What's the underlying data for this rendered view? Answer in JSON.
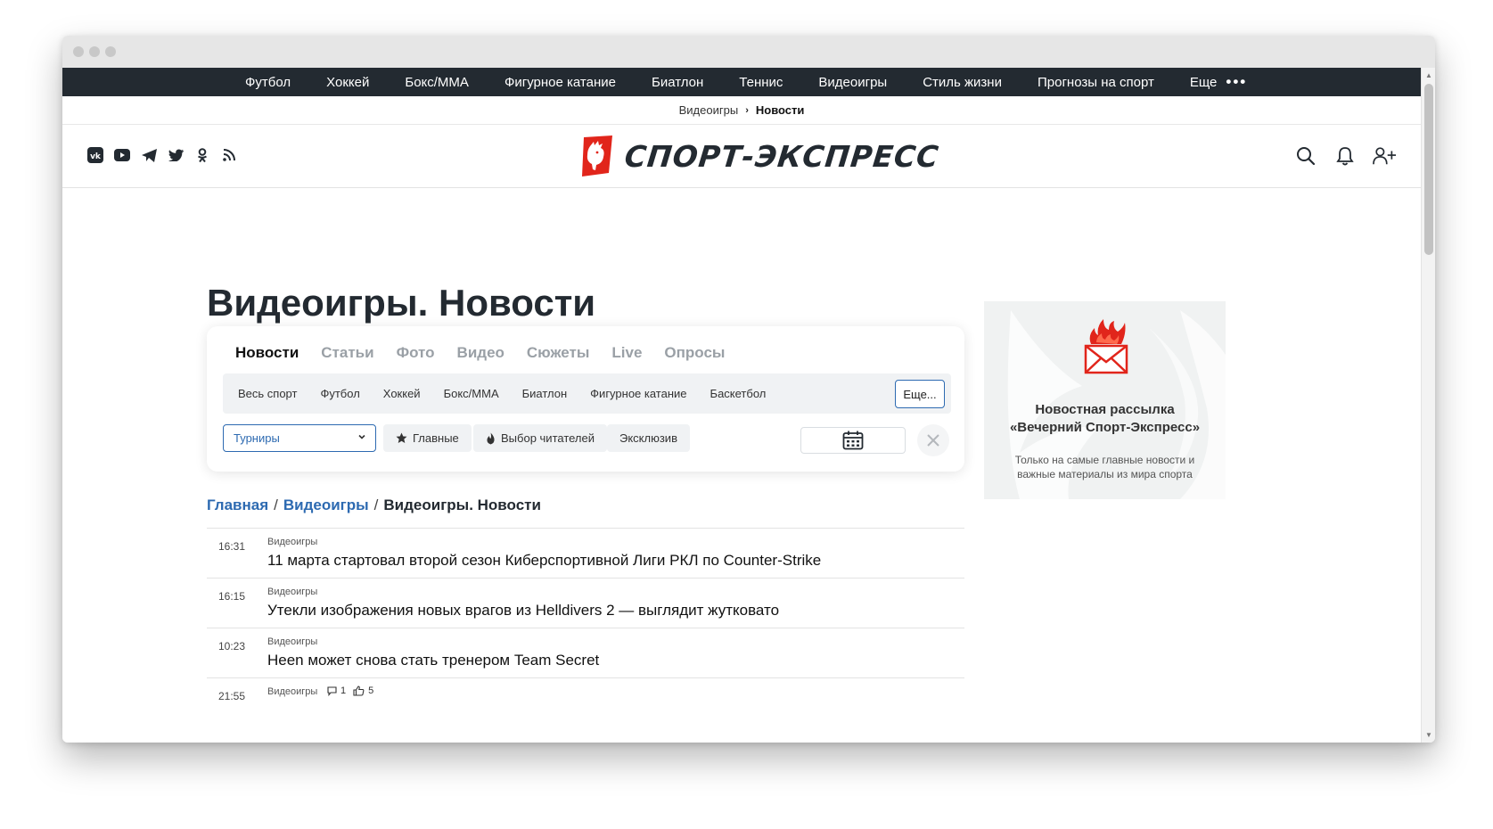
{
  "topnav": {
    "items": [
      "Футбол",
      "Хоккей",
      "Бокс/ММА",
      "Фигурное катание",
      "Биатлон",
      "Теннис",
      "Видеоигры",
      "Стиль жизни",
      "Прогнозы на спорт",
      "Еще"
    ],
    "more_dots": "•••"
  },
  "subnav": {
    "parent": "Видеоигры",
    "separator": "›",
    "current": "Новости"
  },
  "header": {
    "logo_text": "СПОРТ-ЭКСПРЕСС",
    "brand_color": "#e1251b",
    "social_icons": [
      "vk-icon",
      "youtube-icon",
      "telegram-icon",
      "twitter-icon",
      "odnoklassniki-icon",
      "rss-icon"
    ],
    "actions": [
      "search-icon",
      "bell-icon",
      "add-user-icon"
    ]
  },
  "page": {
    "title": "Видеоигры. Новости"
  },
  "filters": {
    "tabs": [
      {
        "label": "Новости",
        "active": true
      },
      {
        "label": "Статьи",
        "active": false
      },
      {
        "label": "Фото",
        "active": false
      },
      {
        "label": "Видео",
        "active": false
      },
      {
        "label": "Сюжеты",
        "active": false
      },
      {
        "label": "Live",
        "active": false
      },
      {
        "label": "Опросы",
        "active": false
      }
    ],
    "sports": [
      "Весь спорт",
      "Футбол",
      "Хоккей",
      "Бокс/ММА",
      "Биатлон",
      "Фигурное катание",
      "Баскетбол"
    ],
    "sports_more": "Еще...",
    "tournaments_select": "Турниры",
    "pill_main": "Главные",
    "pill_readers": "Выбор читателей",
    "pill_exclusive": "Эксклюзив"
  },
  "breadcrumb": {
    "home": "Главная",
    "section": "Видеоигры",
    "current": "Видеоигры. Новости",
    "separator": "/"
  },
  "news": [
    {
      "time": "16:31",
      "category": "Видеоигры",
      "title": "11 марта стартовал второй сезон Киберспортивной Лиги РКЛ по Counter-Strike"
    },
    {
      "time": "16:15",
      "category": "Видеоигры",
      "title": "Утекли изображения новых врагов из Helldivers 2 — выглядит жутковато"
    },
    {
      "time": "10:23",
      "category": "Видеоигры",
      "title": "Heen может снова стать тренером Team Secret"
    },
    {
      "time": "21:55",
      "category": "Видеоигры",
      "title": "",
      "comments": "1",
      "likes": "5"
    }
  ],
  "newsletter": {
    "title_line1": "Новостная рассылка",
    "title_line2": "«Вечерний Спорт-Экспресс»",
    "description": "Только на самые главные новости и важные материалы из мира спорта"
  },
  "colors": {
    "accent": "#2d6ab1",
    "nav_bg": "#232a31"
  }
}
